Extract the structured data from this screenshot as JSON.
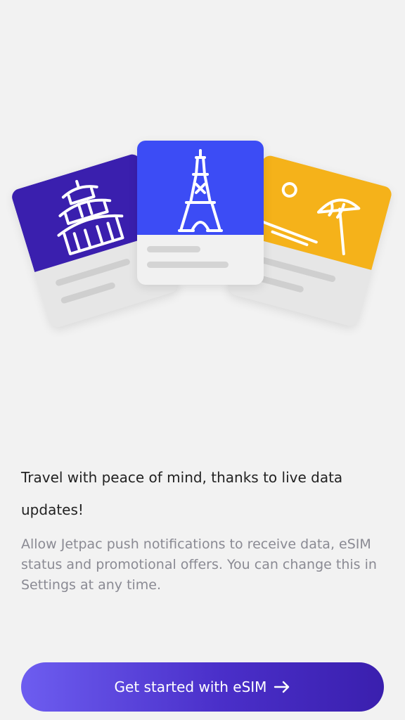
{
  "onboarding": {
    "headline": "Travel with peace of mind, thanks to live data updates!",
    "body": "Allow Jetpac push notifications to receive data, eSIM status and promotional offers. You can change this in Settings at any time."
  },
  "cta": {
    "label": "Get started with eSIM",
    "icon": "arrow-right-icon"
  },
  "illustration": {
    "cards": [
      {
        "name": "temple-card",
        "color": "#3a1fae",
        "icon": "temple-icon"
      },
      {
        "name": "eiffel-tower-card",
        "color": "#3c4cf5",
        "icon": "eiffel-tower-icon"
      },
      {
        "name": "beach-card",
        "color": "#f5b21a",
        "icon": "beach-umbrella-icon"
      }
    ]
  },
  "colors": {
    "background": "#f2f2f2",
    "headline": "#222222",
    "body": "#8a8a93",
    "button_start": "#6d5df0",
    "button_end": "#3a1fae"
  }
}
